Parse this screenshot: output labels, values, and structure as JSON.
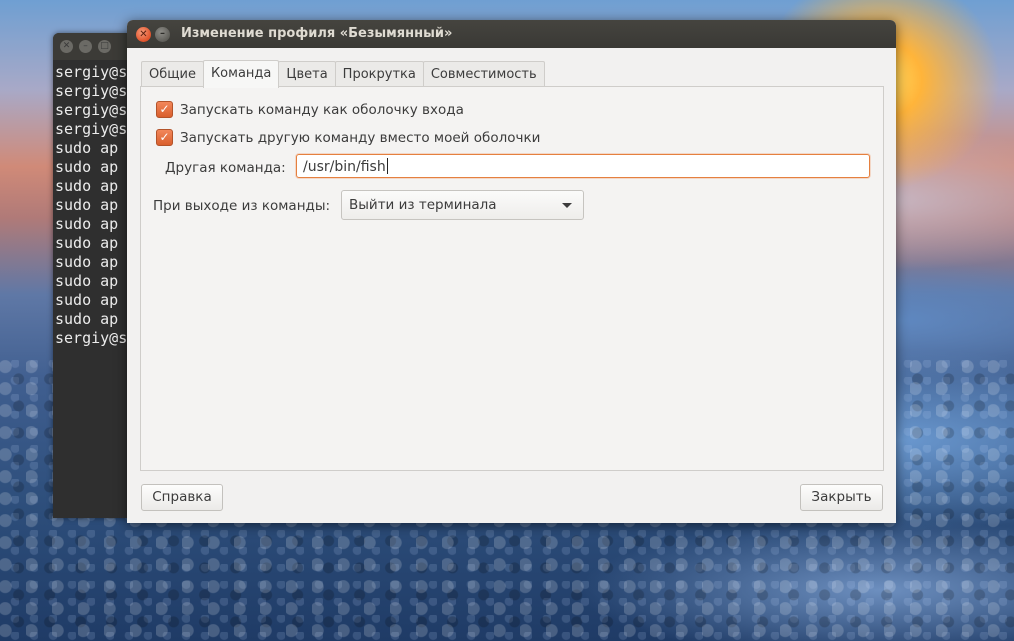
{
  "terminal": {
    "lines": [
      "sergiy@s",
      "sergiy@s",
      "sergiy@s",
      "sergiy@s",
      "sudo ap",
      "sudo ap",
      "sudo ap",
      "sudo ap",
      "sudo ap",
      "sudo ap",
      "sudo ap",
      "sudo ap",
      "sudo ap",
      "sudo ap",
      "sergiy@s"
    ]
  },
  "dialog": {
    "title": "Изменение профиля «Безымянный»",
    "tabs": [
      {
        "label": "Общие",
        "active": false
      },
      {
        "label": "Команда",
        "active": true
      },
      {
        "label": "Цвета",
        "active": false
      },
      {
        "label": "Прокрутка",
        "active": false
      },
      {
        "label": "Совместимость",
        "active": false
      }
    ],
    "options": {
      "login_shell": {
        "label": "Запускать команду как оболочку входа",
        "checked": true
      },
      "custom_command": {
        "label": "Запускать другую команду вместо моей оболочки",
        "checked": true
      }
    },
    "custom_command_label": "Другая команда:",
    "custom_command_value": "/usr/bin/fish",
    "on_exit_label": "При выходе из команды:",
    "on_exit_value": "Выйти из терминала",
    "help_button": "Справка",
    "close_button": "Закрыть"
  },
  "colors": {
    "accent": "#e0622f",
    "titlebar": "#3c3b37",
    "dialog_bg": "#f2f1f0"
  }
}
